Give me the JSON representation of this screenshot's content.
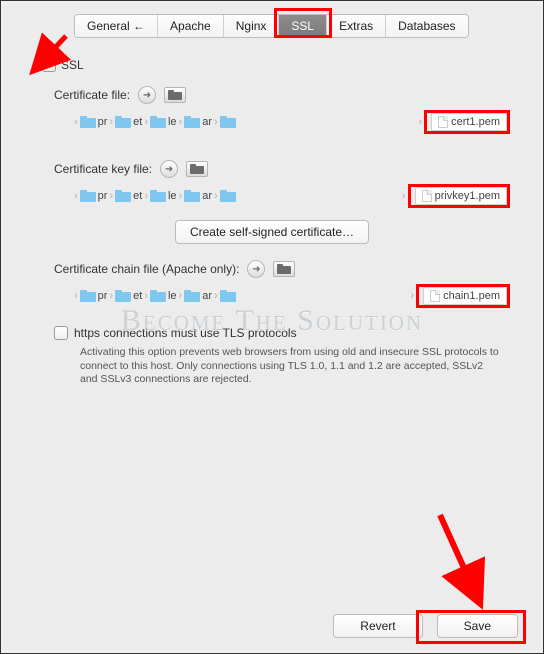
{
  "tabs": {
    "general": "General ←",
    "apache": "Apache",
    "nginx": "Nginx",
    "ssl": "SSL",
    "extras": "Extras",
    "databases": "Databases"
  },
  "ssl_checkbox_label": "SSL",
  "sections": {
    "cert": {
      "label": "Certificate file:",
      "crumbs": [
        "pr",
        "et",
        "le",
        "ar",
        ""
      ],
      "file": "cert1.pem"
    },
    "key": {
      "label": "Certificate key file:",
      "crumbs": [
        "pr",
        "et",
        "le",
        "ar",
        ""
      ],
      "file": "privkey1.pem"
    },
    "chain": {
      "label": "Certificate chain file (Apache only):",
      "crumbs": [
        "pr",
        "et",
        "le",
        "ar",
        ""
      ],
      "file": "chain1.pem"
    }
  },
  "create_self_signed": "Create self-signed certificate…",
  "tls_checkbox_label": "https connections must use TLS protocols",
  "tls_description": "Activating this option prevents web browsers from using old and insecure SSL protocols to connect to this host. Only connections using TLS 1.0, 1.1 and 1.2 are accepted, SSLv2 and SSLv3 connections are rejected.",
  "buttons": {
    "revert": "Revert",
    "save": "Save"
  },
  "watermark": "Become The Solution"
}
